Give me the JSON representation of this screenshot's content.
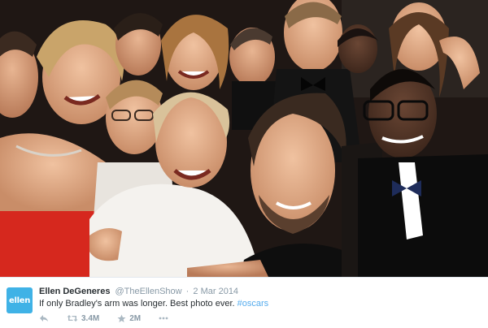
{
  "tweet": {
    "avatar_text": "ellen",
    "display_name": "Ellen DeGeneres",
    "handle": "@TheEllenShow",
    "separator": "·",
    "date": "2 Mar 2014",
    "text": "If only Bradley's arm was longer. Best photo ever.",
    "hashtag": "#oscars",
    "retweet_count": "3.4M",
    "favorite_count": "2M"
  },
  "icons": {
    "reply": "reply-icon",
    "retweet": "retweet-icon",
    "favorite": "star-icon",
    "more": "more-icon"
  },
  "colors": {
    "avatar_bg": "#3fb2e6",
    "hashtag": "#55acee",
    "muted": "#8899a6",
    "text": "#292f33"
  }
}
